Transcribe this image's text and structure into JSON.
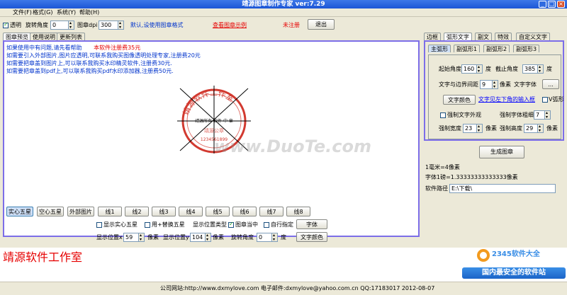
{
  "window": {
    "title": "靖源图章制作专家  ver:7.29"
  },
  "menu": [
    "文件(F)",
    "格式(G)",
    "系统(Y)",
    "帮助(H)"
  ],
  "toolbar": {
    "transparent_label": "透明",
    "rotate_label": "旋转角度",
    "rotate_value": "0",
    "dpi_label": "图章dpi",
    "dpi_value": "300",
    "default_text": "默认,设使用图章格式",
    "view_samples": "查看图章示例",
    "unregistered": "未注册",
    "exit": "退出"
  },
  "left_tabs": [
    "图章预览",
    "使用说明",
    "更新列表"
  ],
  "info": {
    "line1": "如果使用中有问题,请先看帮助",
    "line1_red": "本软件注册费35元",
    "line2": "如需要引入外部图片,图片应透明,可联系我购买图像透明处理专家,注册费20元",
    "line3": "如需要把章盖到图片上,可以联系我购买水印精灵软件,注册费30元.",
    "line4": "如需要把章盖到pdf上,可以联系我购买pdf水印添加器,注册费50元."
  },
  "stamp": {
    "arc_text": "靖源软件工作室",
    "center_text": "靖源所有 软件 中  章",
    "bottom_text": "靖源公章",
    "number": "1234561899"
  },
  "watermark": "www.DuoTe.com",
  "star_buttons": [
    "实心五星",
    "空心五星",
    "外部图片",
    "线1",
    "线2",
    "线3",
    "线4",
    "线5",
    "线6",
    "线7",
    "线8"
  ],
  "bottom_controls": {
    "show_star": "显示实心五星",
    "replace_star": "用+替换五星",
    "position_type": "显示位置类型",
    "stamp_center": "图章当中",
    "custom": "自行指定",
    "font_btn": "字体",
    "pos_x_label": "显示位置x",
    "pos_x_value": "59",
    "px1": "像素",
    "pos_y_label": "显示位置y",
    "pos_y_value": "104",
    "px2": "像素",
    "rotate_label": "旋转角度",
    "rotate_value": "0",
    "degree": "度",
    "text_color_btn": "文字颜色"
  },
  "company_title": "靖源软件工作室",
  "right_tabs": [
    "边框",
    "弧形文字",
    "副文",
    "特效",
    "自定义文字"
  ],
  "sub_tabs": [
    "主弧形",
    "副弧形1",
    "副弧形2",
    "副弧形3"
  ],
  "arc_panel": {
    "start_angle_label": "起始角度",
    "start_angle_value": "160",
    "deg1": "度",
    "end_angle_label": "截止角度",
    "end_angle_value": "385",
    "deg2": "度",
    "border_spacing_label": "文字与边界间距",
    "border_spacing_value": "9",
    "px": "像素",
    "font_label": "文字字体",
    "font_btn": "...",
    "color_btn": "文字颜色",
    "input_hint": "文字见左下角的输入框",
    "v_arc": "V弧形",
    "force_style": "强制文字外观",
    "force_bold_label": "强制字体粗细",
    "force_bold_value": "7",
    "force_width_label": "强制宽度",
    "force_width_value": "23",
    "px_w": "像素",
    "force_height_label": "强制高度",
    "force_height_value": "29",
    "px_h": "像素"
  },
  "generate_btn": "生成图章",
  "right_info": {
    "mm": "1毫米=4像素",
    "font_size": "字体1磅=1.33333333333333像素",
    "path_label": "软件路径",
    "path_value": "E:\\下载\\"
  },
  "status": {
    "site": "公司网站:http://www.dxmylove.com  电子邮件:dxmylove@yahoo.com.cn  QQ:17183017   2012-08-07"
  },
  "brand_watermark": {
    "logo": "2345软件大全",
    "slogan": "国内最安全的软件站"
  }
}
